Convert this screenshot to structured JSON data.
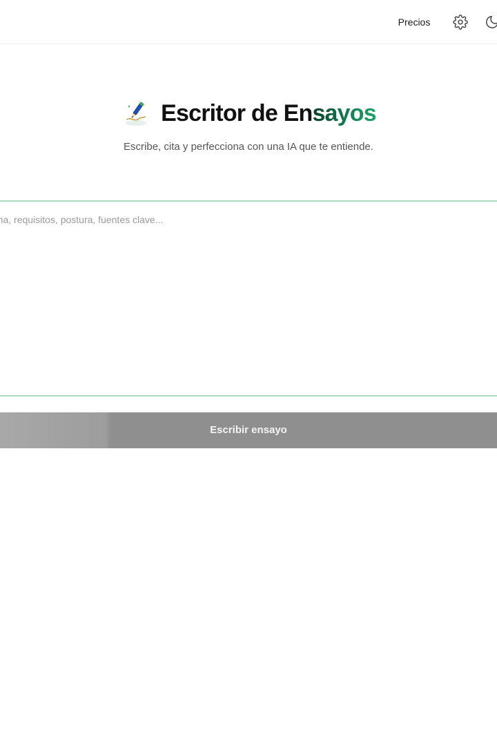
{
  "header": {
    "pricing_label": "Precios",
    "settings_icon": "gear-icon",
    "theme_icon": "moon-icon"
  },
  "hero": {
    "title_main": "Escritor de En",
    "title_accent": "sayos",
    "subtitle": "Escribe, cita y perfecciona con una IA que te entiende.",
    "logo_icon": "pen-writing-icon"
  },
  "composer": {
    "placeholder": "Tema, requisitos, postura, fuentes clave...",
    "value": ""
  },
  "submit": {
    "label": "Escribir ensayo"
  },
  "colors": {
    "accent_start": "#0b3f2a",
    "accent_end": "#1fa56a",
    "border": "#a9d9c0",
    "button_bg": "#8f8f8f"
  }
}
